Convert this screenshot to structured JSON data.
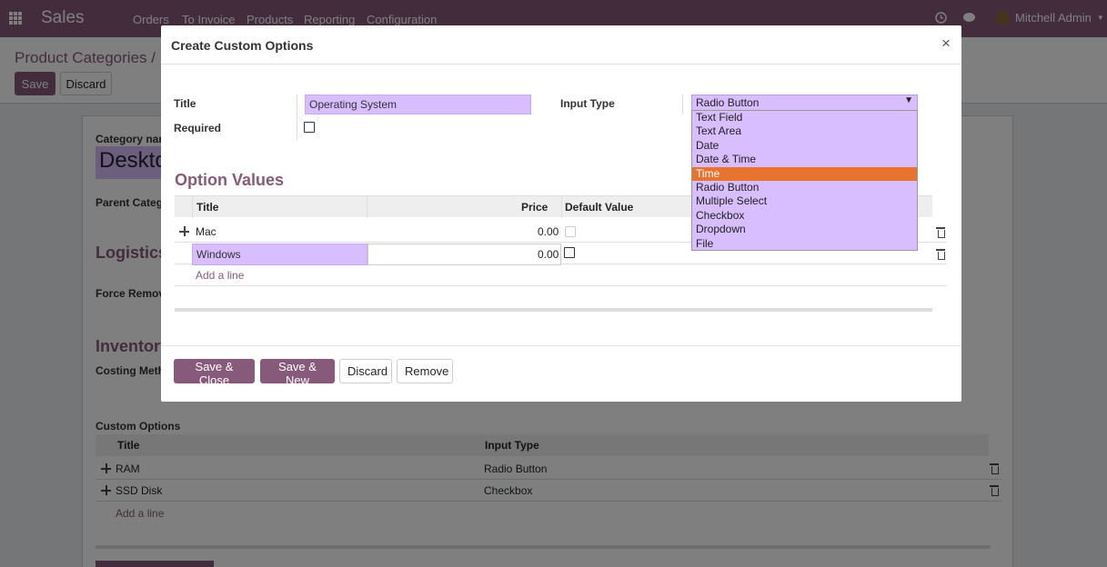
{
  "navbar": {
    "app_name": "Sales",
    "menu": [
      "Orders",
      "To Invoice",
      "Products",
      "Reporting",
      "Configuration"
    ],
    "user_name": "Mitchell Admin"
  },
  "control_panel": {
    "breadcrumb": "Product Categories / N",
    "save_label": "Save",
    "discard_label": "Discard"
  },
  "sheet": {
    "category_name_label": "Category nar",
    "category_name_value": "Deskto",
    "parent_category_label": "Parent Categ",
    "logistics_title": "Logistics",
    "force_removal_label": "Force Remov",
    "inventory_title": "Inventory",
    "costing_method_label": "Costing Meth",
    "custom_options_label": "Custom Options",
    "custom_options_headers": [
      "Title",
      "Input Type"
    ],
    "custom_options_rows": [
      {
        "title": "RAM",
        "input_type": "Radio Button"
      },
      {
        "title": "SSD Disk",
        "input_type": "Checkbox"
      }
    ],
    "add_line": "Add a line"
  },
  "modal": {
    "title": "Create Custom Options",
    "close_symbol": "×",
    "title_label": "Title",
    "title_value": "Operating System",
    "required_label": "Required",
    "input_type_label": "Input Type",
    "input_type_value": "Radio Button",
    "option_values_title": "Option Values",
    "headers": {
      "title": "Title",
      "price": "Price",
      "default_value": "Default Value"
    },
    "rows": [
      {
        "title": "Mac",
        "price": "0.00"
      },
      {
        "title": "Windows",
        "price": "0.00"
      }
    ],
    "add_line": "Add a line",
    "buttons": {
      "save_close": "Save & Close",
      "save_new": "Save & New",
      "discard": "Discard",
      "remove": "Remove"
    }
  },
  "dropdown": {
    "options": [
      "Text Field",
      "Text Area",
      "Date",
      "Date & Time",
      "Time",
      "Radio Button",
      "Multiple Select",
      "Checkbox",
      "Dropdown",
      "File"
    ],
    "highlighted": "Time"
  },
  "colors": {
    "brand": "#875a7b",
    "highlight": "#e8732e",
    "field_fill": "#d8bdff"
  }
}
